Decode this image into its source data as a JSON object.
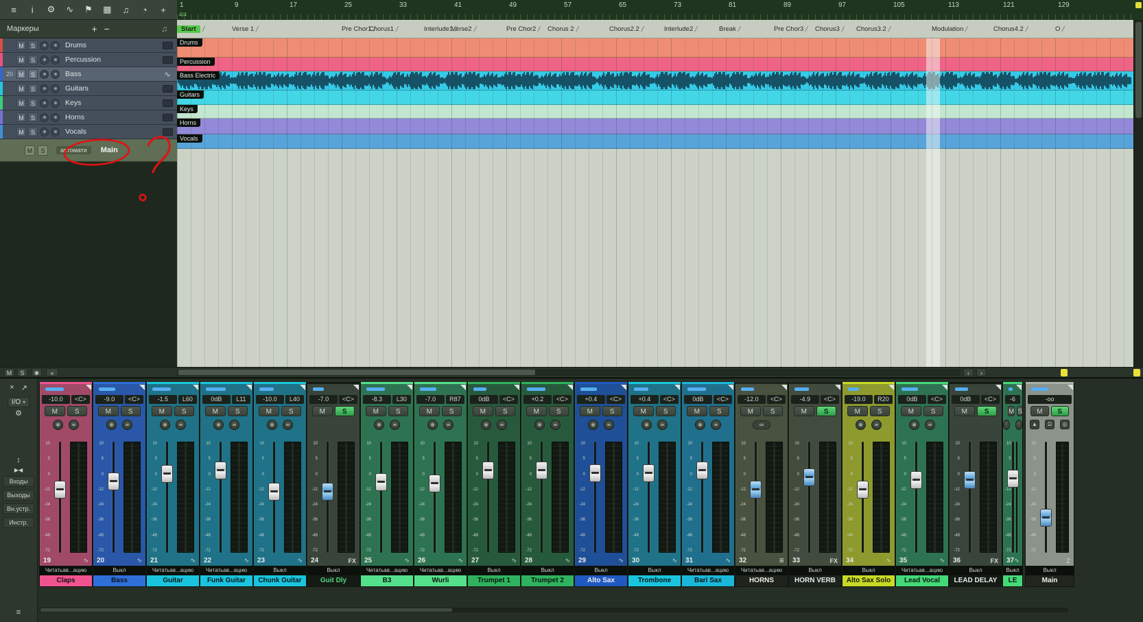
{
  "colors": {
    "annotation_red": "#e01212",
    "meter_blue": "#56aef2",
    "solo_green": "#3fae4f",
    "start_marker_green": "#57c94b"
  },
  "toolbar": {
    "icons": [
      {
        "name": "menu",
        "glyph": "≡"
      },
      {
        "name": "info",
        "glyph": "i"
      },
      {
        "name": "tool",
        "glyph": "⚙"
      },
      {
        "name": "automation-curve",
        "glyph": "∿"
      },
      {
        "name": "marker-flag",
        "glyph": "⚑"
      },
      {
        "name": "grid",
        "glyph": "▦"
      },
      {
        "name": "notes",
        "glyph": "♫"
      },
      {
        "name": "metronome",
        "glyph": "◔"
      },
      {
        "name": "add",
        "glyph": "+"
      }
    ]
  },
  "markers_panel": {
    "title": "Маркеры",
    "add": "+",
    "remove": "−",
    "music": "♫"
  },
  "ruler": {
    "time_signature": "4/4",
    "bars": [
      1,
      9,
      17,
      25,
      33,
      41,
      49,
      57,
      65,
      73,
      81,
      89,
      97,
      105,
      113,
      121,
      129
    ]
  },
  "markers": [
    {
      "label": "Start",
      "bar": 1,
      "highlighted": true
    },
    {
      "label": "Verse 1",
      "bar": 9
    },
    {
      "label": "Pre Chor1",
      "bar": 25
    },
    {
      "label": "Chorus1",
      "bar": 29
    },
    {
      "label": "Interlude1",
      "bar": 37
    },
    {
      "label": "Verse2",
      "bar": 41
    },
    {
      "label": "Pre Chor2",
      "bar": 49
    },
    {
      "label": "Chorus 2",
      "bar": 55
    },
    {
      "label": "Chorus2.2",
      "bar": 64
    },
    {
      "label": "Interlude2",
      "bar": 72
    },
    {
      "label": "Break",
      "bar": 80
    },
    {
      "label": "Pre Chor3",
      "bar": 88
    },
    {
      "label": "Chorus3",
      "bar": 94
    },
    {
      "label": "Chorus3.2",
      "bar": 100
    },
    {
      "label": "Modulation",
      "bar": 111
    },
    {
      "label": "Chorus4.2",
      "bar": 120
    },
    {
      "label": "O",
      "bar": 129
    }
  ],
  "track_buttons": {
    "m": "M",
    "s": "S"
  },
  "tracks": [
    {
      "name": "Drums",
      "row_num": "",
      "strip": "#d84f46",
      "lane_label": "Drums",
      "lane_bg": "#ef8d74",
      "lane_h": 28,
      "icon": "folder"
    },
    {
      "name": "Percussion",
      "row_num": "",
      "strip": "#e85480",
      "lane_label": "Percussion",
      "lane_bg": "#ef6486",
      "lane_h": 20,
      "icon": "folder"
    },
    {
      "name": "Bass",
      "row_num": "20",
      "strip": "#3566cc",
      "lane_label": "Bass Electric",
      "lane_bg": "#35cbe8",
      "lane_h": 28,
      "icon": "wave",
      "selected": true,
      "waveform": true
    },
    {
      "name": "Guitars",
      "row_num": "",
      "strip": "#27c6dd",
      "lane_label": "Guitars",
      "lane_bg": "#43d6e6",
      "lane_h": 21,
      "icon": "folder"
    },
    {
      "name": "Keys",
      "row_num": "",
      "strip": "#3dcc7a",
      "lane_label": "Keys",
      "lane_bg": "#c2e6d0",
      "lane_h": 20,
      "icon": "folder",
      "keys_lines": true
    },
    {
      "name": "Horns",
      "row_num": "",
      "strip": "#7a6fd6",
      "lane_label": "Horns",
      "lane_bg": "#9289d8",
      "lane_h": 23,
      "icon": "folder"
    },
    {
      "name": "Vocals",
      "row_num": "",
      "strip": "#3f8fd8",
      "lane_label": "Vocals",
      "lane_bg": "#58a4da",
      "lane_h": 21,
      "icon": "folder"
    }
  ],
  "main_track": {
    "m": "M",
    "s": "S",
    "mode": "автомати",
    "name": "Main"
  },
  "scrollbar_row": {
    "m": "M",
    "s": "S",
    "power": "◉",
    "back": "«",
    "left": "‹",
    "right": "›"
  },
  "mixer": {
    "sidebar": {
      "close": "×",
      "popout": "↗",
      "io": "I/O",
      "io_arrow": "▾",
      "tool": "⚙",
      "updown": "↕",
      "narrow": "▶◀",
      "items": [
        "Входы",
        "Выходы",
        "Вн.устр.",
        "Инстр."
      ],
      "menu": "≡"
    },
    "mute_label": "M",
    "solo_label": "S",
    "fader_scale": [
      "10",
      "5",
      "0",
      "-12",
      "-24",
      "-36",
      "-48",
      "-72"
    ],
    "channels": [
      {
        "num": "19",
        "name": "Claps",
        "gain": "-10.0",
        "pan": "<C>",
        "body": "#a04a68",
        "name_bg": "#f0538f",
        "name_fg": "#141414",
        "auto": "Читатьав...ацию",
        "fader": 0.42,
        "blue": false,
        "icon": "auto",
        "rec": "rec",
        "solo": false,
        "meter": 0.5
      },
      {
        "num": "20",
        "name": "Bass",
        "gain": "-9.0",
        "pan": "<C>",
        "body": "#2a57a8",
        "name_bg": "#2f6fd8",
        "name_fg": "#0d1420",
        "auto": "Выкл",
        "fader": 0.33,
        "blue": false,
        "icon": "auto",
        "rec": "rec",
        "solo": false,
        "meter": 0.45
      },
      {
        "num": "21",
        "name": "Guitar",
        "gain": "-1.5",
        "pan": "L60",
        "body": "#1f7287",
        "name_bg": "#19c5de",
        "name_fg": "#0c1416",
        "auto": "Читатьав...ацию",
        "fader": 0.25,
        "blue": false,
        "icon": "auto",
        "rec": "rec",
        "solo": false,
        "meter": 0.5
      },
      {
        "num": "22",
        "name": "Funk Guitar",
        "gain": "0dB",
        "pan": "L11",
        "body": "#1f7287",
        "name_bg": "#19c5de",
        "name_fg": "#0c1416",
        "auto": "Читатьав...ацию",
        "fader": 0.21,
        "blue": false,
        "icon": "auto",
        "rec": "rec",
        "solo": false,
        "meter": 0.55
      },
      {
        "num": "23",
        "name": "Chunk Guitar",
        "gain": "-10.0",
        "pan": "L40",
        "body": "#1f7287",
        "name_bg": "#19c5de",
        "name_fg": "#0c1416",
        "auto": "Выкл",
        "fader": 0.44,
        "blue": false,
        "icon": "auto",
        "rec": "rec",
        "solo": false,
        "meter": 0.4
      },
      {
        "num": "24",
        "name": "Guit Dly",
        "gain": "-7.0",
        "pan": "<C>",
        "body": "#39453a",
        "name_bg": "#141a14",
        "name_fg": "#4fd47f",
        "auto": "Выкл",
        "fader": 0.44,
        "blue": true,
        "icon": "fx",
        "rec": "none",
        "solo": true,
        "meter": 0.3
      },
      {
        "num": "25",
        "name": "B3",
        "gain": "-8.3",
        "pan": "L30",
        "body": "#2e7351",
        "name_bg": "#55e08b",
        "name_fg": "#0d160f",
        "auto": "Читатьав...ацию",
        "fader": 0.34,
        "blue": false,
        "icon": "auto",
        "rec": "rec",
        "solo": false,
        "meter": 0.5
      },
      {
        "num": "26",
        "name": "Wurli",
        "gain": "-7.0",
        "pan": "R87",
        "body": "#2e7351",
        "name_bg": "#55e08b",
        "name_fg": "#0d160f",
        "auto": "Читатьав...ацию",
        "fader": 0.35,
        "blue": false,
        "icon": "auto",
        "rec": "rec",
        "solo": false,
        "meter": 0.45
      },
      {
        "num": "27",
        "name": "Trumpet 1",
        "gain": "0dB",
        "pan": "<C>",
        "body": "#275a3c",
        "name_bg": "#2fb35e",
        "name_fg": "#0c130d",
        "auto": "Выкл",
        "fader": 0.21,
        "blue": false,
        "icon": "auto",
        "rec": "rec",
        "solo": false,
        "meter": 0.35
      },
      {
        "num": "28",
        "name": "Trumpet 2",
        "gain": "+0.2",
        "pan": "<C>",
        "body": "#275a3c",
        "name_bg": "#2fb35e",
        "name_fg": "#0c130d",
        "auto": "Выкл",
        "fader": 0.21,
        "blue": false,
        "icon": "auto",
        "rec": "rec",
        "solo": false,
        "meter": 0.5
      },
      {
        "num": "29",
        "name": "Alto Sax",
        "gain": "+0.4",
        "pan": "<C>",
        "body": "#1f4f96",
        "name_bg": "#2059c0",
        "name_fg": "#e8ecf2",
        "auto": "Выкл",
        "fader": 0.24,
        "blue": false,
        "icon": "auto",
        "rec": "rec",
        "solo": false,
        "meter": 0.45
      },
      {
        "num": "30",
        "name": "Trombone",
        "gain": "+0.4",
        "pan": "<C>",
        "body": "#1f7287",
        "name_bg": "#19c5de",
        "name_fg": "#0c1416",
        "auto": "Выкл",
        "fader": 0.24,
        "blue": false,
        "icon": "auto",
        "rec": "rec",
        "solo": false,
        "meter": 0.4
      },
      {
        "num": "31",
        "name": "Bari Sax",
        "gain": "0dB",
        "pan": "<C>",
        "body": "#20708d",
        "name_bg": "#1ab8d8",
        "name_fg": "#0c1416",
        "auto": "Читатьав...ацию",
        "fader": 0.21,
        "blue": false,
        "icon": "auto",
        "rec": "rec",
        "solo": false,
        "meter": 0.5
      },
      {
        "num": "32",
        "name": "HORNS",
        "gain": "-12.0",
        "pan": "<C>",
        "body": "#49513f",
        "name_bg": "#1e241c",
        "name_fg": "#e9ece9",
        "auto": "Читатьав...ацию",
        "fader": 0.42,
        "blue": true,
        "icon": "bus",
        "rec": "link",
        "solo": false,
        "meter": 0.35
      },
      {
        "num": "33",
        "name": "HORN VERB",
        "gain": "-4.9",
        "pan": "<C>",
        "body": "#414c3e",
        "name_bg": "#1c221c",
        "name_fg": "#e9ece9",
        "auto": "Выкл",
        "fader": 0.29,
        "blue": true,
        "icon": "fx",
        "rec": "none",
        "solo": true,
        "meter": 0.4
      },
      {
        "num": "34",
        "name": "Alto Sax Solo",
        "gain": "-19.0",
        "pan": "R20",
        "body": "#8e9a2e",
        "name_bg": "#c9da25",
        "name_fg": "#141607",
        "auto": "Выкл",
        "fader": 0.42,
        "blue": false,
        "icon": "auto",
        "rec": "rec",
        "solo": false,
        "meter": 0.3
      },
      {
        "num": "35",
        "name": "Lead Vocal",
        "gain": "0dB",
        "pan": "<C>",
        "body": "#2e7351",
        "name_bg": "#45d877",
        "name_fg": "#0c150e",
        "auto": "Читатьав...ацию",
        "fader": 0.32,
        "blue": false,
        "icon": "auto",
        "rec": "rec",
        "solo": false,
        "meter": 0.45
      },
      {
        "num": "36",
        "name": "LEAD DELAY",
        "gain": "0dB",
        "pan": "<C>",
        "body": "#39453a",
        "name_bg": "#141a14",
        "name_fg": "#e9ece9",
        "auto": "Выкл",
        "fader": 0.32,
        "blue": true,
        "icon": "fx",
        "rec": "none",
        "solo": true,
        "meter": 0.35
      },
      {
        "num": "37",
        "name": "LE",
        "gain": "-6",
        "pan": "",
        "body": "#2e7351",
        "name_bg": "#45d877",
        "name_fg": "#0c150e",
        "auto": "Выкл",
        "fader": 0.3,
        "blue": false,
        "icon": "auto",
        "rec": "rec",
        "solo": false,
        "meter": 0.3,
        "clipped": true
      },
      {
        "num": "",
        "name": "Main",
        "gain": "-oo",
        "pan": "",
        "body": "#8b938a",
        "cap": "#aab2a8",
        "name_bg": "#20261e",
        "name_fg": "#eef0ee",
        "auto": "Выкл",
        "fader": 0.72,
        "blue": true,
        "icon": "z",
        "rec": "main",
        "solo": true,
        "meter": 0.5,
        "is_main": true
      }
    ]
  },
  "annotation": {
    "shapes": [
      "ellipse-around-main",
      "question-mark",
      "dot"
    ],
    "color": "#e01212"
  }
}
